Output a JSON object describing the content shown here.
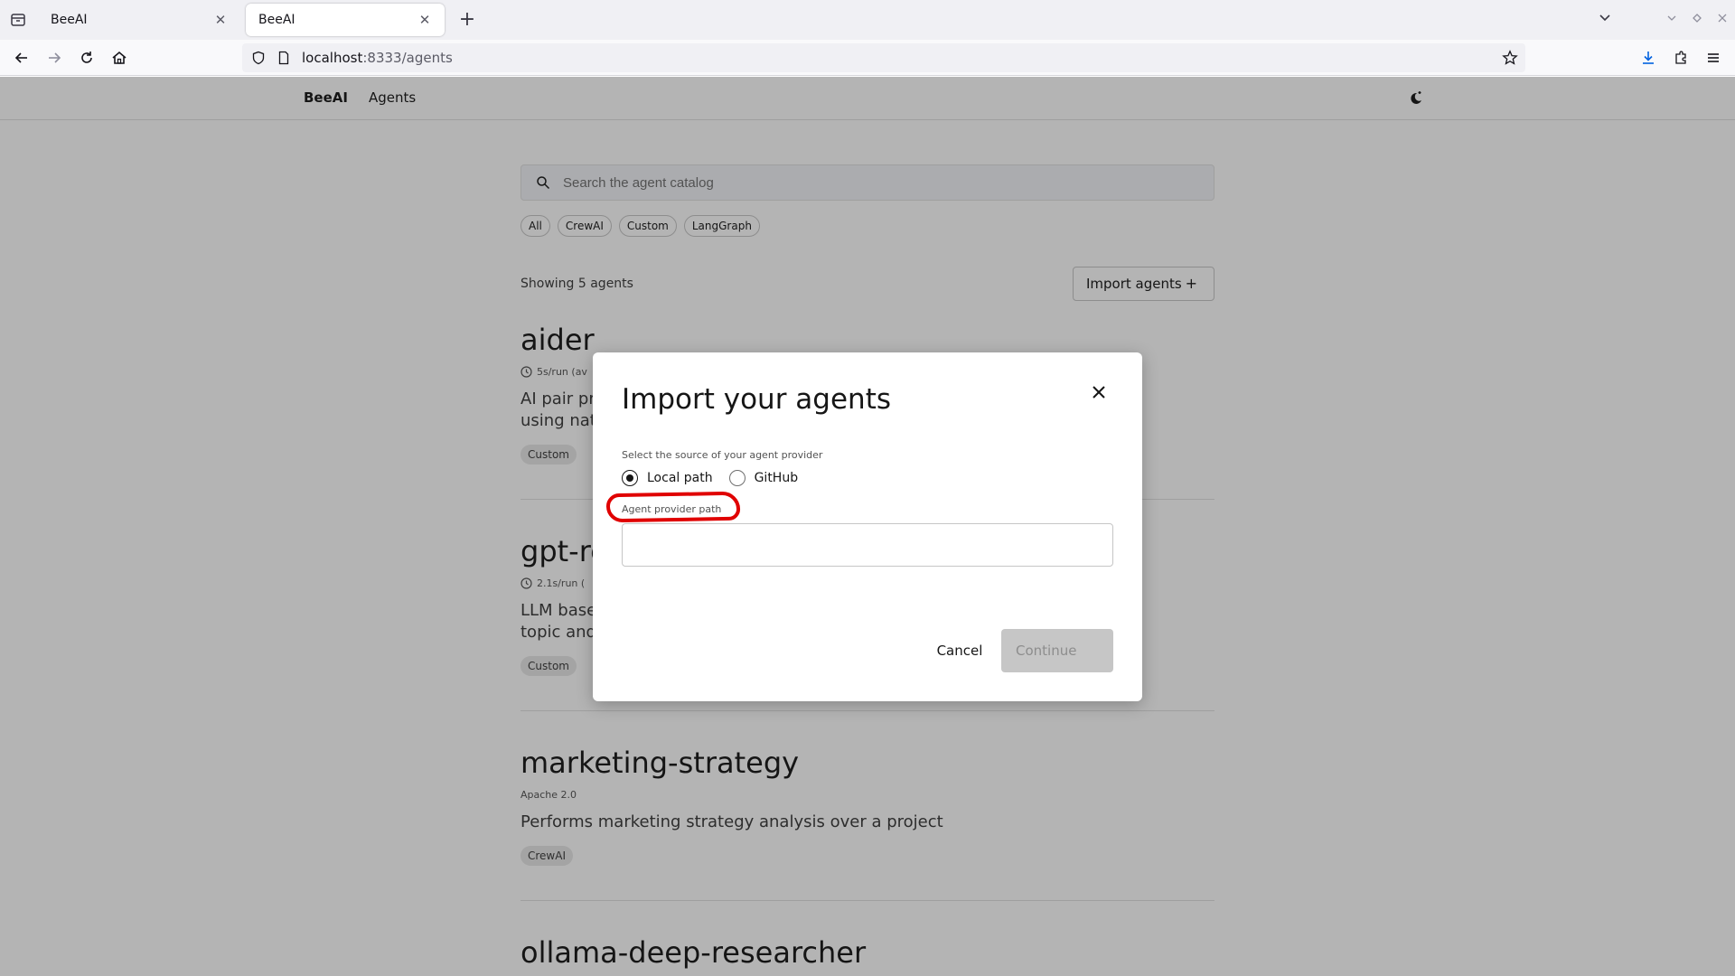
{
  "browser": {
    "tabs": [
      {
        "title": "BeeAI"
      },
      {
        "title": "BeeAI"
      }
    ],
    "url_host": "localhost",
    "url_rest": ":8333/agents"
  },
  "app": {
    "brand": "BeeAI",
    "nav_agents": "Agents"
  },
  "search": {
    "placeholder": "Search the agent catalog"
  },
  "filters": [
    "All",
    "CrewAI",
    "Custom",
    "LangGraph"
  ],
  "catalog": {
    "count_text": "Showing 5 agents",
    "import_label": "Import agents",
    "import_plus": "+"
  },
  "agents": [
    {
      "name": "aider",
      "meta": "5s/run (av",
      "desc": "AI pair pro\nusing natu",
      "tag": "Custom"
    },
    {
      "name": "gpt-re",
      "meta": "2.1s/run (",
      "desc": "LLM based\ntopic and",
      "tag": "Custom"
    },
    {
      "name": "marketing-strategy",
      "meta": "Apache 2.0",
      "desc": "Performs marketing strategy analysis over a project",
      "tag": "CrewAI"
    },
    {
      "name": "ollama-deep-researcher",
      "meta": "",
      "desc": "",
      "tag": ""
    }
  ],
  "modal": {
    "title": "Import your agents",
    "source_label": "Select the source of your agent provider",
    "radio_local": "Local path",
    "radio_github": "GitHub",
    "selected_source": "Local path",
    "path_label": "Agent provider path",
    "path_value": "",
    "cancel_label": "Cancel",
    "continue_label": "Continue"
  },
  "colors": {
    "annotation": "#e00000",
    "overlay": "rgba(22,22,22,0.32)"
  }
}
